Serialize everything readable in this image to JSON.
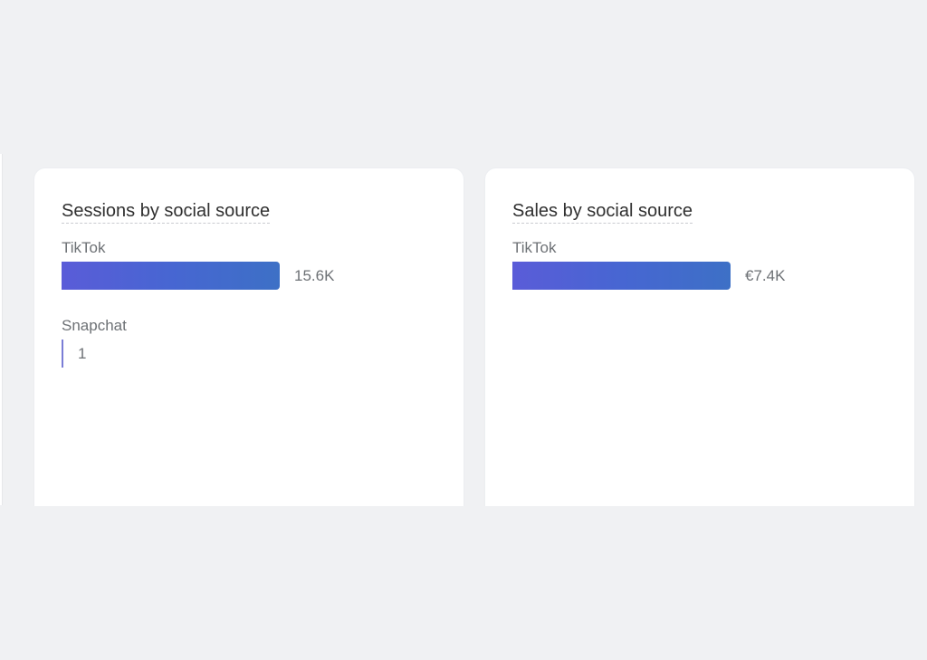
{
  "cards": [
    {
      "title": "Sessions by social source",
      "rows": [
        {
          "label": "TikTok",
          "value_text": "15.6K",
          "value": 15600
        },
        {
          "label": "Snapchat",
          "value_text": "1",
          "value": 1
        }
      ]
    },
    {
      "title": "Sales by social source",
      "rows": [
        {
          "label": "TikTok",
          "value_text": "€7.4K",
          "value": 7400
        }
      ]
    }
  ],
  "colors": {
    "bar_start": "#5a5cd8",
    "bar_end": "#3d70c6",
    "background": "#f0f1f3",
    "card": "#ffffff"
  }
}
